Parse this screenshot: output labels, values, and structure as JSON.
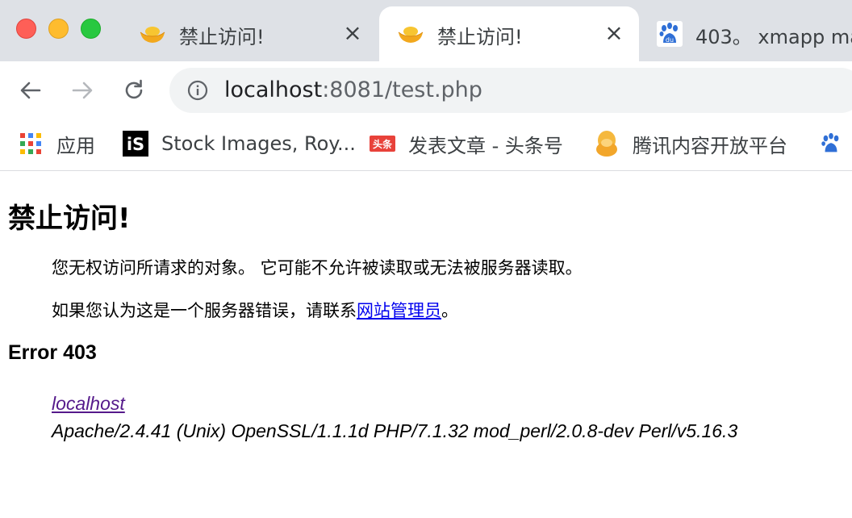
{
  "tabs": [
    {
      "title": "禁止访问!",
      "favicon": "gold-ingot-icon",
      "active": false
    },
    {
      "title": "禁止访问!",
      "favicon": "gold-ingot-icon",
      "active": true
    },
    {
      "title": "403。 xmapp ma",
      "favicon": "baidu-paw-icon",
      "active": false
    }
  ],
  "toolbar": {
    "url_host": "localhost",
    "url_rest": ":8081/test.php"
  },
  "bookmarks": [
    {
      "label": "应用",
      "icon": "apps-grid-icon"
    },
    {
      "label": "Stock Images, Roy...",
      "icon": "istock-icon"
    },
    {
      "label": "发表文章 - 头条号",
      "icon": "toutiao-icon"
    },
    {
      "label": "腾讯内容开放平台",
      "icon": "penguin-icon"
    },
    {
      "label": "",
      "icon": "baidu-paw-icon"
    }
  ],
  "toutiao_badge": "头条",
  "istock_badge": "iS",
  "baidu_badge": "du",
  "page": {
    "heading": "禁止访问!",
    "message": "您无权访问所请求的对象。 它可能不允许被读取或无法被服务器读取。",
    "contact_prefix": "如果您认为这是一个服务器错误，请联系",
    "contact_link": "网站管理员",
    "contact_suffix": "。",
    "error_code": "Error 403",
    "server_host": "localhost",
    "server_signature": "Apache/2.4.41 (Unix) OpenSSL/1.1.1d PHP/7.1.32 mod_perl/2.0.8-dev Perl/v5.16.3"
  },
  "colors": {
    "tabstrip": "#dee1e6",
    "link": "#0000ee",
    "visited_link": "#551a8b",
    "close_red": "#fe5f57",
    "minimize_yellow": "#febc2e",
    "zoom_green": "#28c840"
  }
}
